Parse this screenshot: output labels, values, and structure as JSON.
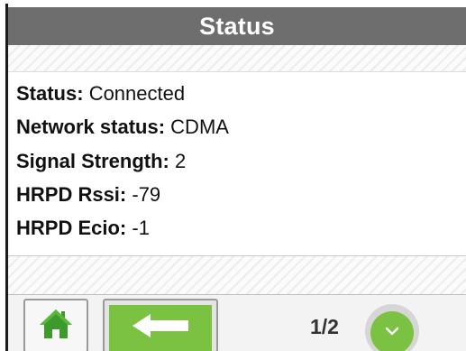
{
  "header": {
    "title": "Status"
  },
  "status_rows": [
    {
      "label": "Status:",
      "value": "Connected"
    },
    {
      "label": "Network status:",
      "value": "CDMA"
    },
    {
      "label": "Signal Strength:",
      "value": "2"
    },
    {
      "label": "HRPD Rssi:",
      "value": "-79"
    },
    {
      "label": "HRPD Ecio:",
      "value": "-1"
    }
  ],
  "footer": {
    "home_icon": "home-icon",
    "back_icon": "arrow-left-icon",
    "page_indicator": "1/2",
    "next_icon": "chevron-down-icon"
  },
  "colors": {
    "title_bar": "#6e6e6e",
    "accent_green": "#7cc242",
    "home_green": "#3f9a2e"
  }
}
